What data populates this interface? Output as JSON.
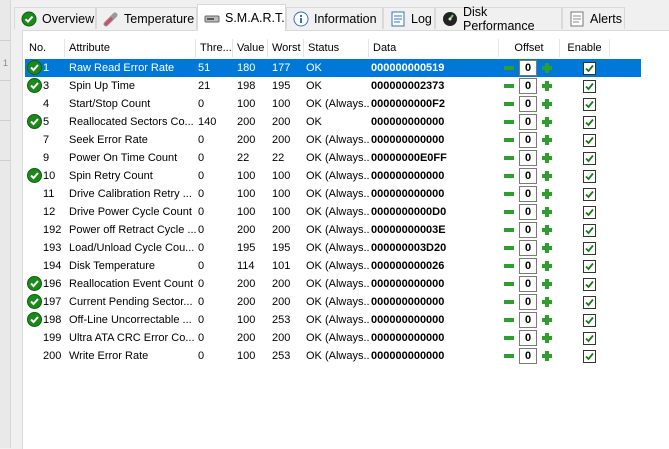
{
  "tabs": [
    {
      "label": "Overview",
      "icon": "ok-check-icon"
    },
    {
      "label": "Temperature",
      "icon": "thermometer-icon"
    },
    {
      "label": "S.M.A.R.T.",
      "icon": "smart-drive-icon"
    },
    {
      "label": "Information",
      "icon": "info-icon"
    },
    {
      "label": "Log",
      "icon": "log-document-icon"
    },
    {
      "label": "Disk Performance",
      "icon": "gauge-icon"
    },
    {
      "label": "Alerts",
      "icon": "alert-document-icon"
    }
  ],
  "active_tab": "S.M.A.R.T.",
  "left_strip_label": "1",
  "table": {
    "headers": {
      "no": "No.",
      "attribute": "Attribute",
      "threshold": "Thre...",
      "value": "Value",
      "worst": "Worst",
      "status": "Status",
      "data": "Data",
      "offset": "Offset",
      "enable": "Enable"
    },
    "rows": [
      {
        "no": "1",
        "attribute": "Raw Read Error Rate",
        "threshold": "51",
        "value": "180",
        "worst": "177",
        "status": "OK",
        "data": "000000000519",
        "offset": "0",
        "enabled": true,
        "ok_icon": true,
        "selected": true
      },
      {
        "no": "3",
        "attribute": "Spin Up Time",
        "threshold": "21",
        "value": "198",
        "worst": "195",
        "status": "OK",
        "data": "000000002373",
        "offset": "0",
        "enabled": true,
        "ok_icon": true,
        "selected": false
      },
      {
        "no": "4",
        "attribute": "Start/Stop Count",
        "threshold": "0",
        "value": "100",
        "worst": "100",
        "status": "OK (Always...",
        "data": "0000000000F2",
        "offset": "0",
        "enabled": true,
        "ok_icon": false,
        "selected": false
      },
      {
        "no": "5",
        "attribute": "Reallocated Sectors Co...",
        "threshold": "140",
        "value": "200",
        "worst": "200",
        "status": "OK",
        "data": "000000000000",
        "offset": "0",
        "enabled": true,
        "ok_icon": true,
        "selected": false
      },
      {
        "no": "7",
        "attribute": "Seek Error Rate",
        "threshold": "0",
        "value": "200",
        "worst": "200",
        "status": "OK (Always...",
        "data": "000000000000",
        "offset": "0",
        "enabled": true,
        "ok_icon": false,
        "selected": false
      },
      {
        "no": "9",
        "attribute": "Power On Time Count",
        "threshold": "0",
        "value": "22",
        "worst": "22",
        "status": "OK (Always...",
        "data": "00000000E0FF",
        "offset": "0",
        "enabled": true,
        "ok_icon": false,
        "selected": false
      },
      {
        "no": "10",
        "attribute": "Spin Retry Count",
        "threshold": "0",
        "value": "100",
        "worst": "100",
        "status": "OK (Always...",
        "data": "000000000000",
        "offset": "0",
        "enabled": true,
        "ok_icon": true,
        "selected": false
      },
      {
        "no": "11",
        "attribute": "Drive Calibration Retry ...",
        "threshold": "0",
        "value": "100",
        "worst": "100",
        "status": "OK (Always...",
        "data": "000000000000",
        "offset": "0",
        "enabled": true,
        "ok_icon": false,
        "selected": false
      },
      {
        "no": "12",
        "attribute": "Drive Power Cycle Count",
        "threshold": "0",
        "value": "100",
        "worst": "100",
        "status": "OK (Always...",
        "data": "0000000000D0",
        "offset": "0",
        "enabled": true,
        "ok_icon": false,
        "selected": false
      },
      {
        "no": "192",
        "attribute": "Power off Retract Cycle ...",
        "threshold": "0",
        "value": "200",
        "worst": "200",
        "status": "OK (Always...",
        "data": "00000000003E",
        "offset": "0",
        "enabled": true,
        "ok_icon": false,
        "selected": false
      },
      {
        "no": "193",
        "attribute": "Load/Unload Cycle Cou...",
        "threshold": "0",
        "value": "195",
        "worst": "195",
        "status": "OK (Always...",
        "data": "000000003D20",
        "offset": "0",
        "enabled": true,
        "ok_icon": false,
        "selected": false
      },
      {
        "no": "194",
        "attribute": "Disk Temperature",
        "threshold": "0",
        "value": "114",
        "worst": "101",
        "status": "OK (Always...",
        "data": "000000000026",
        "offset": "0",
        "enabled": true,
        "ok_icon": false,
        "selected": false
      },
      {
        "no": "196",
        "attribute": "Reallocation Event Count",
        "threshold": "0",
        "value": "200",
        "worst": "200",
        "status": "OK (Always...",
        "data": "000000000000",
        "offset": "0",
        "enabled": true,
        "ok_icon": true,
        "selected": false
      },
      {
        "no": "197",
        "attribute": "Current Pending Sector...",
        "threshold": "0",
        "value": "200",
        "worst": "200",
        "status": "OK (Always...",
        "data": "000000000000",
        "offset": "0",
        "enabled": true,
        "ok_icon": true,
        "selected": false
      },
      {
        "no": "198",
        "attribute": "Off-Line Uncorrectable ...",
        "threshold": "0",
        "value": "100",
        "worst": "253",
        "status": "OK (Always...",
        "data": "000000000000",
        "offset": "0",
        "enabled": true,
        "ok_icon": true,
        "selected": false
      },
      {
        "no": "199",
        "attribute": "Ultra ATA CRC Error Co...",
        "threshold": "0",
        "value": "200",
        "worst": "200",
        "status": "OK (Always...",
        "data": "000000000000",
        "offset": "0",
        "enabled": true,
        "ok_icon": false,
        "selected": false
      },
      {
        "no": "200",
        "attribute": "Write Error Rate",
        "threshold": "0",
        "value": "100",
        "worst": "253",
        "status": "OK (Always...",
        "data": "000000000000",
        "offset": "0",
        "enabled": true,
        "ok_icon": false,
        "selected": false
      }
    ]
  },
  "colors": {
    "selection": "#0078d7",
    "ok_green": "#1a8a1a",
    "spinner_green": "#2e9e2e"
  }
}
